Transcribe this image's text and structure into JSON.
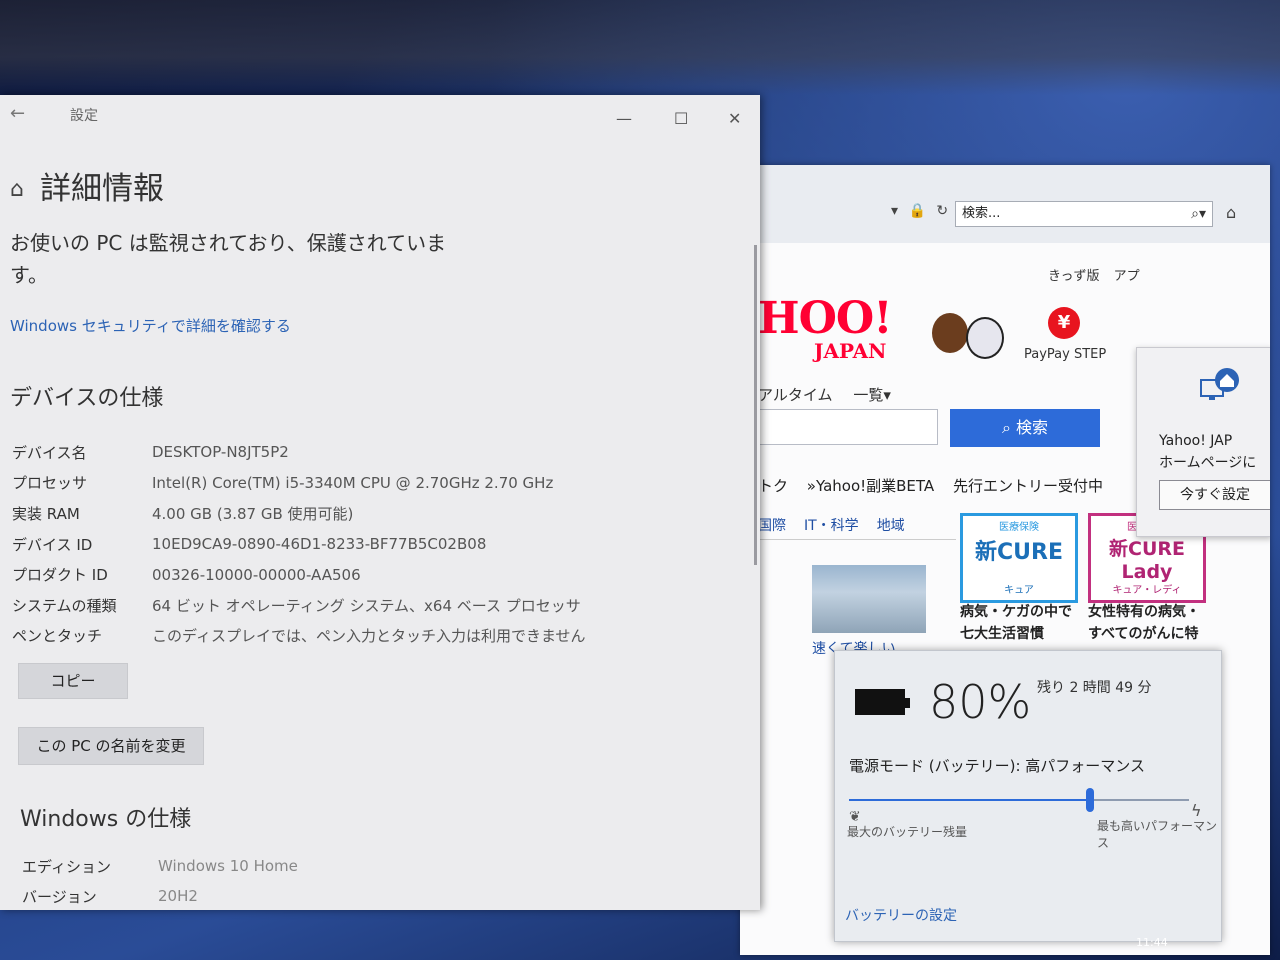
{
  "settings": {
    "title": "設定",
    "header": "詳細情報",
    "protect_text": "お使いの PC は監視されており、保護されています。",
    "security_link": "Windows セキュリティで詳細を確認する",
    "device_spec_title": "デバイスの仕様",
    "device_specs": [
      {
        "key": "デバイス名",
        "value": "DESKTOP-N8JT5P2"
      },
      {
        "key": "プロセッサ",
        "value": "Intel(R) Core(TM) i5-3340M CPU @ 2.70GHz   2.70 GHz"
      },
      {
        "key": "実装 RAM",
        "value": "4.00 GB (3.87 GB 使用可能)"
      },
      {
        "key": "デバイス ID",
        "value": "10ED9CA9-0890-46D1-8233-BF77B5C02B08"
      },
      {
        "key": "プロダクト ID",
        "value": "00326-10000-00000-AA506"
      },
      {
        "key": "システムの種類",
        "value": "64 ビット オペレーティング システム、x64 ベース プロセッサ"
      },
      {
        "key": "ペンとタッチ",
        "value": "このディスプレイでは、ペン入力とタッチ入力は利用できません"
      }
    ],
    "copy_button": "コピー",
    "rename_button": "この PC の名前を変更",
    "windows_spec_title": "Windows の仕様",
    "windows_specs": [
      {
        "key": "エディション",
        "value": "Windows 10 Home"
      },
      {
        "key": "バージョン",
        "value": "20H2"
      }
    ]
  },
  "browser": {
    "search_placeholder": "検索...",
    "top_links": [
      "きっず版",
      "アプ"
    ],
    "logo_main": "HOO!",
    "logo_sub": "JAPAN",
    "paypay_label": "PayPay STEP",
    "nav_items": [
      "アルタイム",
      "一覧▾"
    ],
    "search_button": "検索",
    "news_links": [
      "トク",
      "»Yahoo!副業BETA",
      "先行エントリー受付中"
    ],
    "categories": [
      "国際",
      "IT・科学",
      "地域"
    ],
    "news_caption": "速くて楽しい",
    "ads": [
      {
        "tag": "医療保険",
        "brand": "新CURE",
        "sub": "キュア",
        "text": "病気・ケガの中で 七大生活習慣"
      },
      {
        "tag": "医療保険",
        "brand": "新CURE Lady",
        "sub": "キュア・レディ",
        "text": "女性特有の病気・ すべてのがんに特"
      }
    ],
    "homepage_popup": {
      "text_line1": "Yahoo! JAP",
      "text_line2": "ホームページに",
      "button": "今すぐ設定"
    }
  },
  "battery": {
    "percent": "80%",
    "remaining": "残り 2 時間 49 分",
    "power_mode": "電源モード (バッテリー): 高パフォーマンス",
    "slider_value": 0.71,
    "left_label": "最大のバッテリー残量",
    "right_label": "最も高いパフォーマンス",
    "settings_link": "バッテリーの設定"
  },
  "taskbar": {
    "clock": "11:44"
  }
}
